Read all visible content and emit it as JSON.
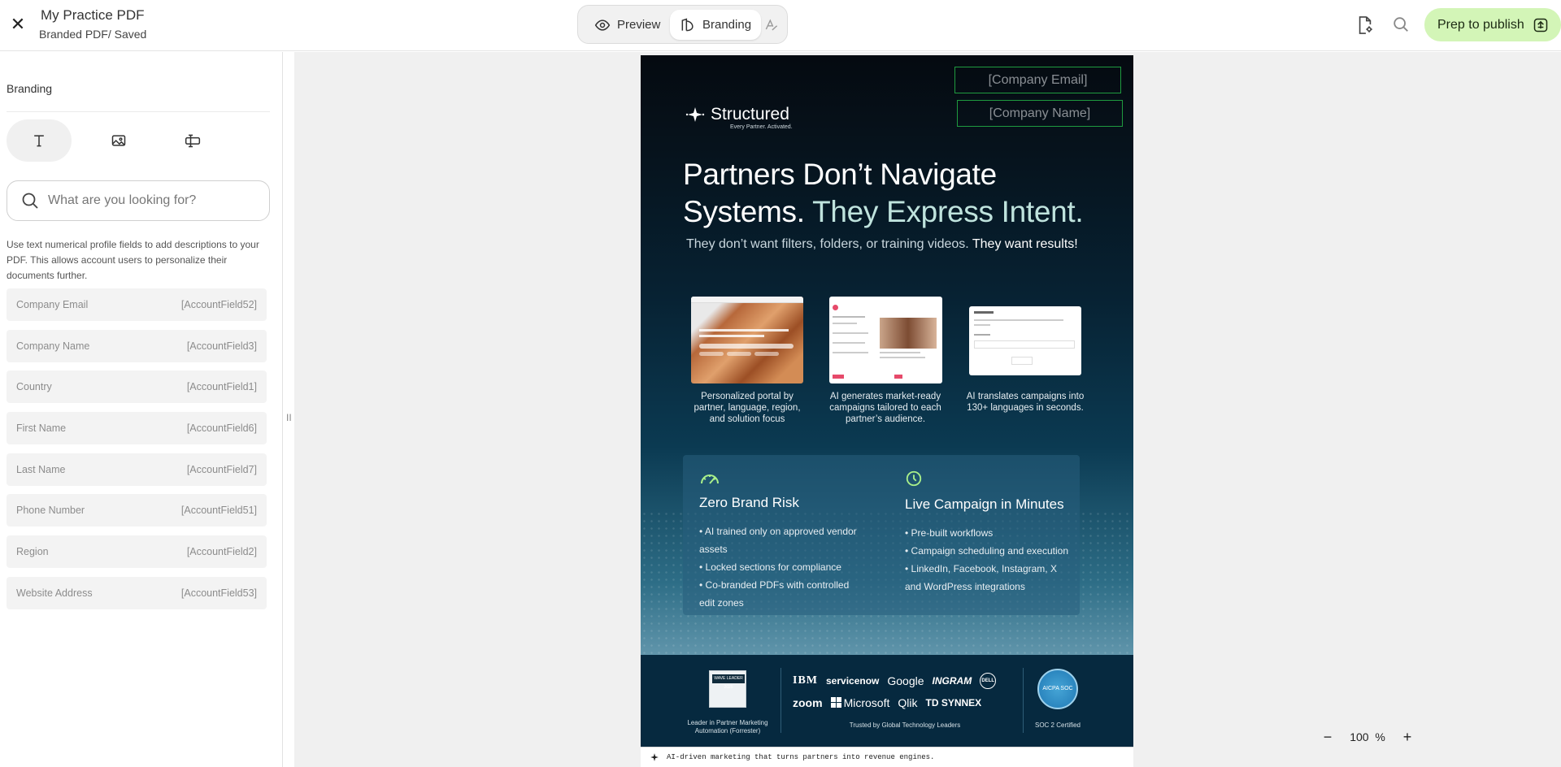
{
  "header": {
    "close_glyph": "✕",
    "doc_title": "My Practice PDF",
    "doc_subtitle": "Branded PDF/ Saved",
    "mode_preview_label": "Preview",
    "mode_branding_label": "Branding",
    "publish_label": "Prep to publish",
    "icons": [
      "file-settings-icon",
      "search-icon",
      "publish-icon",
      "eye-icon",
      "branding-icon",
      "ai-text-icon"
    ]
  },
  "sidebar": {
    "title": "Branding",
    "tabs": [
      {
        "name": "text",
        "icon": "text-icon",
        "active": true
      },
      {
        "name": "image",
        "icon": "image-icon",
        "active": false
      },
      {
        "name": "field",
        "icon": "text-field-icon",
        "active": false
      }
    ],
    "search_placeholder": "What are you looking for?",
    "help_text": "Use text numerical profile fields to add descriptions to your PDF. This allows account users to personalize their documents further.",
    "fields": [
      {
        "label": "Company Email",
        "code": "[AccountField52]"
      },
      {
        "label": "Company Name",
        "code": "[AccountField3]"
      },
      {
        "label": "Country",
        "code": "[AccountField1]"
      },
      {
        "label": "First Name",
        "code": "[AccountField6]"
      },
      {
        "label": "Last Name",
        "code": "[AccountField7]"
      },
      {
        "label": "Phone Number",
        "code": "[AccountField51]"
      },
      {
        "label": "Region",
        "code": "[AccountField2]"
      },
      {
        "label": "Website Address",
        "code": "[AccountField53]"
      }
    ],
    "resize_glyph": "II"
  },
  "pdf": {
    "placeholder_email": "[Company Email]",
    "placeholder_name": "[Company Name]",
    "logo_name": "Structured",
    "logo_tagline": "Every Partner. Activated.",
    "headline_1": "Partners Don’t Navigate",
    "headline_2a": "Systems.",
    "headline_2b": "They Express Intent.",
    "subline_a": "They don’t want filters, folders, or training videos.",
    "subline_b": "They want results!",
    "features": [
      {
        "caption": "Personalized portal by partner, language, region, and solution focus"
      },
      {
        "caption": "AI generates market-ready campaigns tailored to each partner’s audience."
      },
      {
        "caption": "AI translates campaigns into 130+ languages in seconds."
      }
    ],
    "benefits": [
      {
        "icon": "gauge-icon",
        "title": "Zero Brand Risk",
        "items": [
          "• AI trained only on approved vendor assets",
          "• Locked sections for compliance",
          "• Co-branded PDFs with controlled",
          "   edit zones"
        ]
      },
      {
        "icon": "clock-icon",
        "title": "Live Campaign in Minutes",
        "items": [
          "• Pre-built workflows",
          "• Campaign scheduling and execution",
          "• LinkedIn, Facebook, Instagram, X",
          "   and WordPress integrations"
        ]
      }
    ],
    "badge_text": "WAVE LEADER 2025",
    "badge_caption": "Leader in Partner Marketing Automation (Forrester)",
    "partner_logos_row1": [
      "IBM",
      "servicenow",
      "Google",
      "INGRAM",
      "DELL"
    ],
    "partner_logos_row2": [
      "zoom",
      "Microsoft",
      "Qlik",
      "TD SYNNEX"
    ],
    "trusted_caption": "Trusted by Global Technology Leaders",
    "soc_badge_text": "AICPA SOC",
    "soc_caption": "SOC 2 Certified",
    "footer_text": "AI-driven marketing that turns partners into revenue engines."
  },
  "zoom": {
    "minus": "−",
    "value": "100",
    "unit": "%",
    "plus": "+"
  },
  "colors": {
    "accent_publish": "#d3f5b7",
    "placeholder_border": "#1f9b3f",
    "page_dark": "#050a10",
    "headline_soft": "#bfe3dd"
  }
}
